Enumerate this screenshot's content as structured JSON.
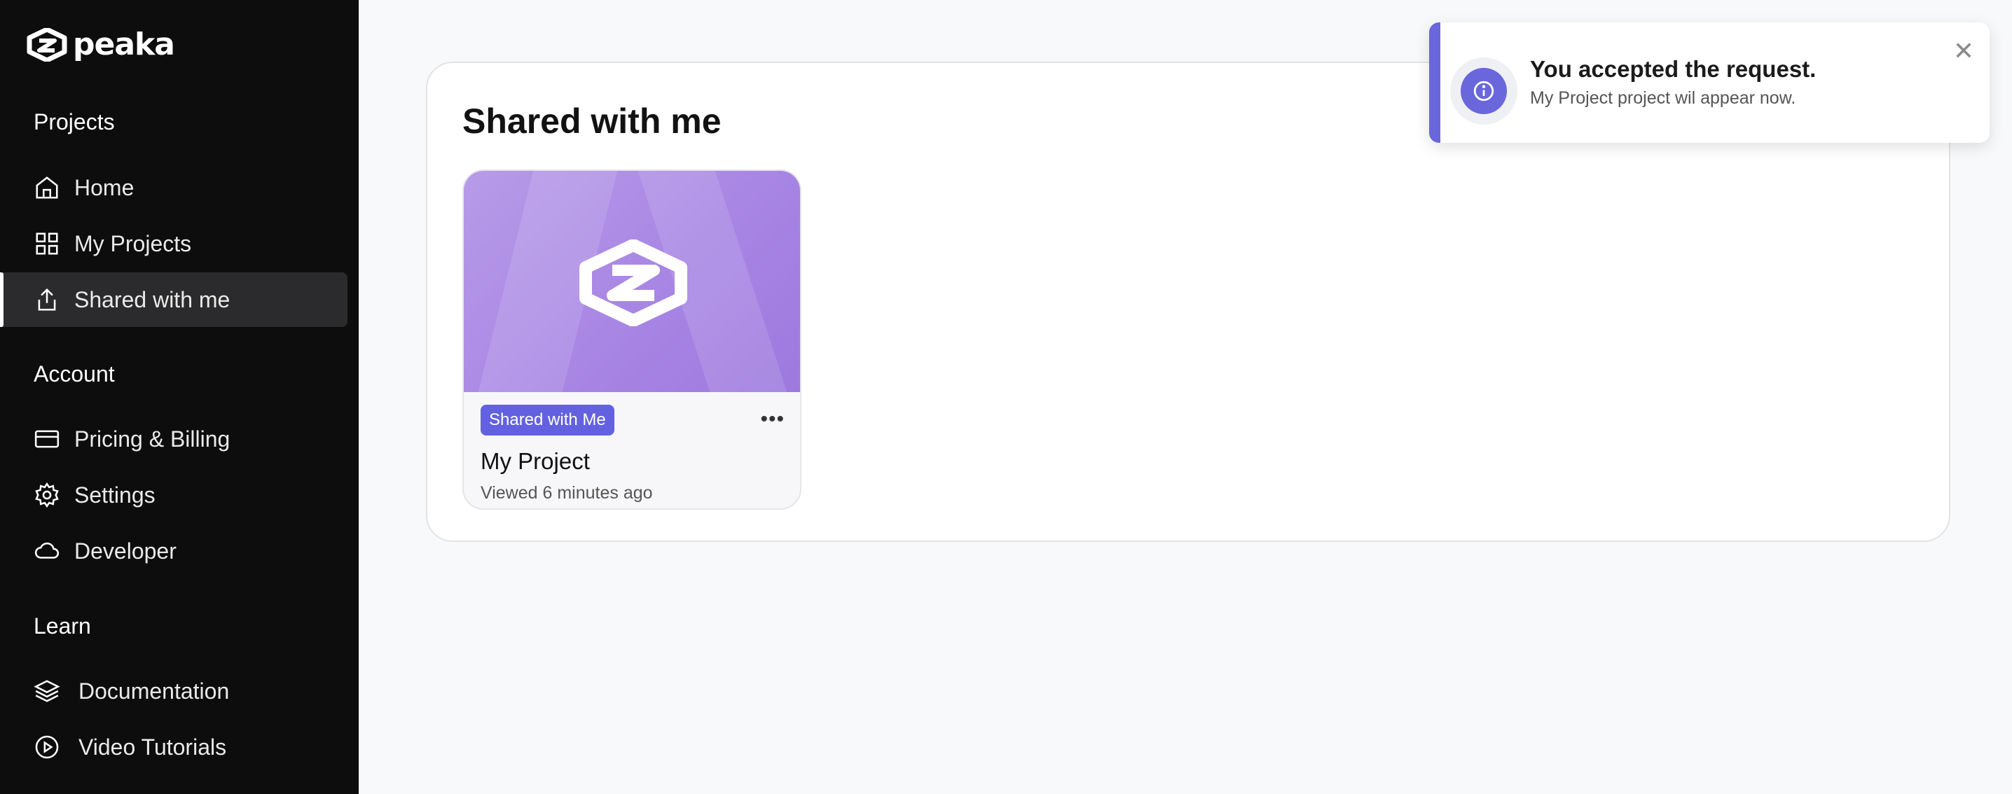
{
  "app": {
    "logo_text": "peaka"
  },
  "sidebar": {
    "sections": [
      {
        "title": "Projects",
        "items": [
          {
            "label": "Home",
            "icon": "home-icon"
          },
          {
            "label": "My Projects",
            "icon": "grid-icon"
          },
          {
            "label": "Shared with me",
            "icon": "share-icon",
            "active": true
          }
        ]
      },
      {
        "title": "Account",
        "items": [
          {
            "label": "Pricing & Billing",
            "icon": "credit-card-icon"
          },
          {
            "label": "Settings",
            "icon": "gear-icon"
          },
          {
            "label": "Developer",
            "icon": "cloud-icon"
          }
        ]
      },
      {
        "title": "Learn",
        "items": [
          {
            "label": "Documentation",
            "icon": "layers-icon"
          },
          {
            "label": "Video Tutorials",
            "icon": "play-circle-icon"
          }
        ]
      }
    ]
  },
  "main": {
    "title": "Shared with me",
    "cards": [
      {
        "badge": "Shared with Me",
        "title": "My Project",
        "subtitle": "Viewed 6 minutes ago"
      }
    ]
  },
  "toast": {
    "title": "You accepted the request.",
    "message": "My Project project wil appear now.",
    "icon": "info-icon"
  },
  "colors": {
    "accent": "#6a66dc",
    "sidebar_bg": "#0d0d0d",
    "badge": "#6361e0"
  }
}
